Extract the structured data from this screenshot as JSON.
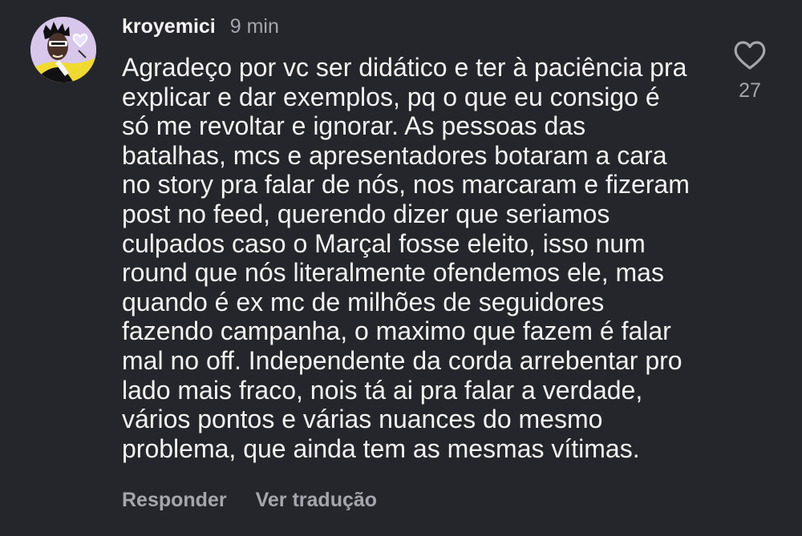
{
  "comment": {
    "username": "kroyemici",
    "time_ago": "9 min",
    "avatar_icon": "profile-avatar-icon",
    "text_lines": [
      "Agradeço por vc ser didático e ter à paciência pra",
      "explicar e dar exemplos, pq o que eu consigo é",
      "só me revoltar e ignorar. As pessoas das",
      "batalhas, mcs e apresentadores botaram a cara",
      "no story pra falar de nós, nos marcaram e fizeram",
      "post no feed, querendo dizer que seriamos",
      "culpados caso o Marçal fosse eleito, isso num",
      "round que nós literalmente ofendemos ele, mas",
      "quando é ex mc de milhões de seguidores",
      "fazendo campanha, o maximo que fazem é falar",
      "mal no off. Independente da corda arrebentar pro",
      "lado mais fraco, nois tá ai pra falar a verdade,",
      "vários pontos e várias nuances do mesmo",
      "problema, que ainda tem as mesmas vítimas."
    ],
    "actions": {
      "reply": "Responder",
      "translate": "Ver tradução"
    },
    "likes": {
      "icon": "heart-outline-icon",
      "count": "27"
    }
  },
  "colors": {
    "background": "#25262b",
    "primary_text": "#f3f3f3",
    "secondary_text": "#a4a6ad"
  }
}
